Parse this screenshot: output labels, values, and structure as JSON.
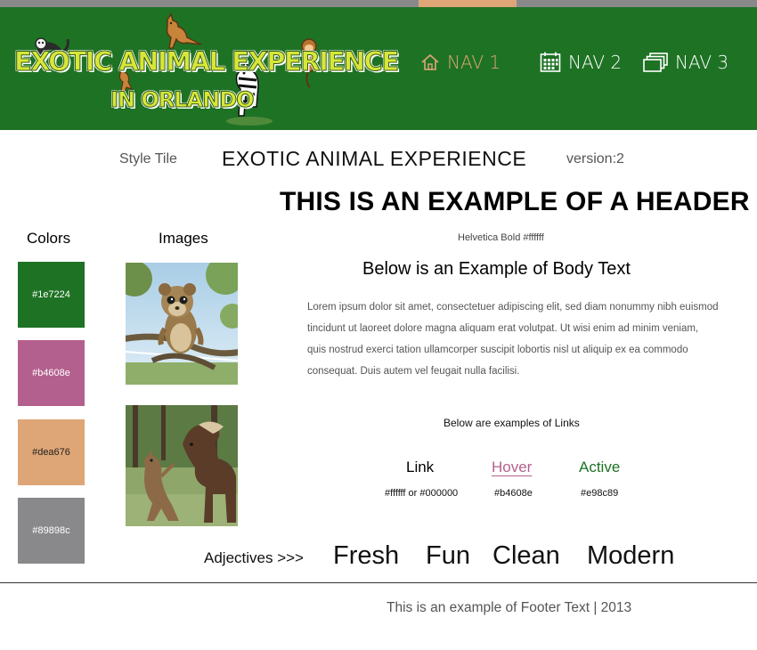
{
  "header": {
    "logo": {
      "title": "EXOTIC ANIMAL EXPERIENCE",
      "subtitle": "IN ORLANDO"
    },
    "nav": [
      {
        "label": "NAV 1",
        "icon": "home-icon",
        "active": true
      },
      {
        "label": "NAV 2",
        "icon": "calendar-icon",
        "active": false
      },
      {
        "label": "NAV 3",
        "icon": "stacked-pages-icon",
        "active": false
      }
    ]
  },
  "style_tile": {
    "label": "Style Tile",
    "title": "EXOTIC ANIMAL EXPERIENCE",
    "version": "version:2"
  },
  "typography": {
    "header_example": "THIS IS AN EXAMPLE OF A HEADER",
    "header_font_note": "Helvetica Bold #ffffff",
    "body_title": "Below is an Example of  Body Text",
    "body_text": "Lorem ipsum dolor sit amet, consectetuer adipiscing elit, sed diam nonummy nibh euismod tincidunt ut laoreet dolore magna aliquam erat volutpat. Ut wisi enim ad minim veniam, quis nostrud exerci tation ullamcorper suscipit lobortis nisl ut aliquip ex ea commodo consequat. Duis autem vel feugait nulla facilisi."
  },
  "colors": {
    "heading": "Colors",
    "swatches": [
      {
        "hex": "#1e7224",
        "label": "#1e7224"
      },
      {
        "hex": "#b4608e",
        "label": "#b4608e"
      },
      {
        "hex": "#dea676",
        "label": "#dea676"
      },
      {
        "hex": "#89898c",
        "label": "#89898c"
      }
    ]
  },
  "images": {
    "heading": "Images",
    "items": [
      "kinkajou-photo",
      "kangaroo-and-pony-photo"
    ]
  },
  "links": {
    "title": "Below are examples of Links",
    "states": [
      {
        "label": "Link",
        "code": "#ffffff or #000000"
      },
      {
        "label": "Hover",
        "code": "#b4608e"
      },
      {
        "label": "Active",
        "code": "#e98c89"
      }
    ]
  },
  "adjectives": {
    "label": "Adjectives >>>",
    "words": [
      "Fresh",
      "Fun",
      "Clean",
      "Modern"
    ]
  },
  "footer": {
    "text": "This is an example of  Footer Text  |  2013"
  }
}
